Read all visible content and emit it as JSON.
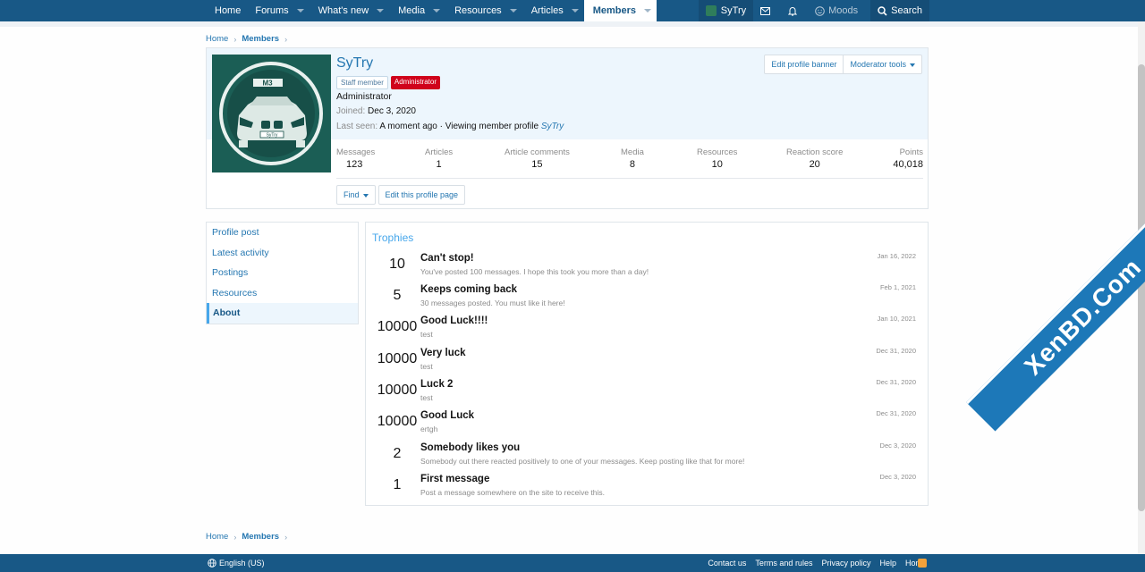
{
  "nav": {
    "tabs": [
      {
        "label": "Home"
      },
      {
        "label": "Forums"
      },
      {
        "label": "What's new"
      },
      {
        "label": "Media"
      },
      {
        "label": "Resources"
      },
      {
        "label": "Articles"
      },
      {
        "label": "Members"
      }
    ],
    "user": "SyTry",
    "moods": "Moods",
    "search": "Search"
  },
  "breadcrumbs": [
    "Home",
    "Members"
  ],
  "profile": {
    "name": "SyTry",
    "badge_staff": "Staff member",
    "badge_admin": "Administrator",
    "user_title": "Administrator",
    "joined_label": "Joined:",
    "joined_value": "Dec 3, 2020",
    "last_seen_label": "Last seen:",
    "last_seen_value": "A moment ago · Viewing member profile",
    "last_seen_link": "SyTry",
    "avatar_text": "M3",
    "plate_text": "SyTry",
    "edit_banner": "Edit profile banner",
    "moderator_tools": "Moderator tools",
    "find": "Find",
    "edit_profile": "Edit this profile page",
    "stats": [
      {
        "label": "Messages",
        "value": "123"
      },
      {
        "label": "Articles",
        "value": "1"
      },
      {
        "label": "Article comments",
        "value": "15"
      },
      {
        "label": "Media",
        "value": "8"
      },
      {
        "label": "Resources",
        "value": "10"
      },
      {
        "label": "Reaction score",
        "value": "20"
      },
      {
        "label": "Points",
        "value": "40,018"
      }
    ]
  },
  "sidebar": {
    "items": [
      {
        "label": "Profile post"
      },
      {
        "label": "Latest activity"
      },
      {
        "label": "Postings"
      },
      {
        "label": "Resources"
      },
      {
        "label": "About"
      }
    ]
  },
  "trophies": {
    "heading": "Trophies",
    "items": [
      {
        "points": "10",
        "title": "Can't stop!",
        "desc": "You've posted 100 messages. I hope this took you more than a day!",
        "date": "Jan 16, 2022"
      },
      {
        "points": "5",
        "title": "Keeps coming back",
        "desc": "30 messages posted. You must like it here!",
        "date": "Feb 1, 2021"
      },
      {
        "points": "10000",
        "title": "Good Luck!!!!",
        "desc": "test",
        "date": "Jan 10, 2021"
      },
      {
        "points": "10000",
        "title": "Very luck",
        "desc": "test",
        "date": "Dec 31, 2020"
      },
      {
        "points": "10000",
        "title": "Luck 2",
        "desc": "test",
        "date": "Dec 31, 2020"
      },
      {
        "points": "10000",
        "title": "Good Luck",
        "desc": "ertgh",
        "date": "Dec 31, 2020"
      },
      {
        "points": "2",
        "title": "Somebody likes you",
        "desc": "Somebody out there reacted positively to one of your messages. Keep posting like that for more!",
        "date": "Dec 3, 2020"
      },
      {
        "points": "1",
        "title": "First message",
        "desc": "Post a message somewhere on the site to receive this.",
        "date": "Dec 3, 2020"
      }
    ]
  },
  "footer": {
    "language": "English (US)",
    "links": [
      "Contact us",
      "Terms and rules",
      "Privacy policy",
      "Help",
      "Home"
    ]
  },
  "watermark": "XenBD.Com"
}
